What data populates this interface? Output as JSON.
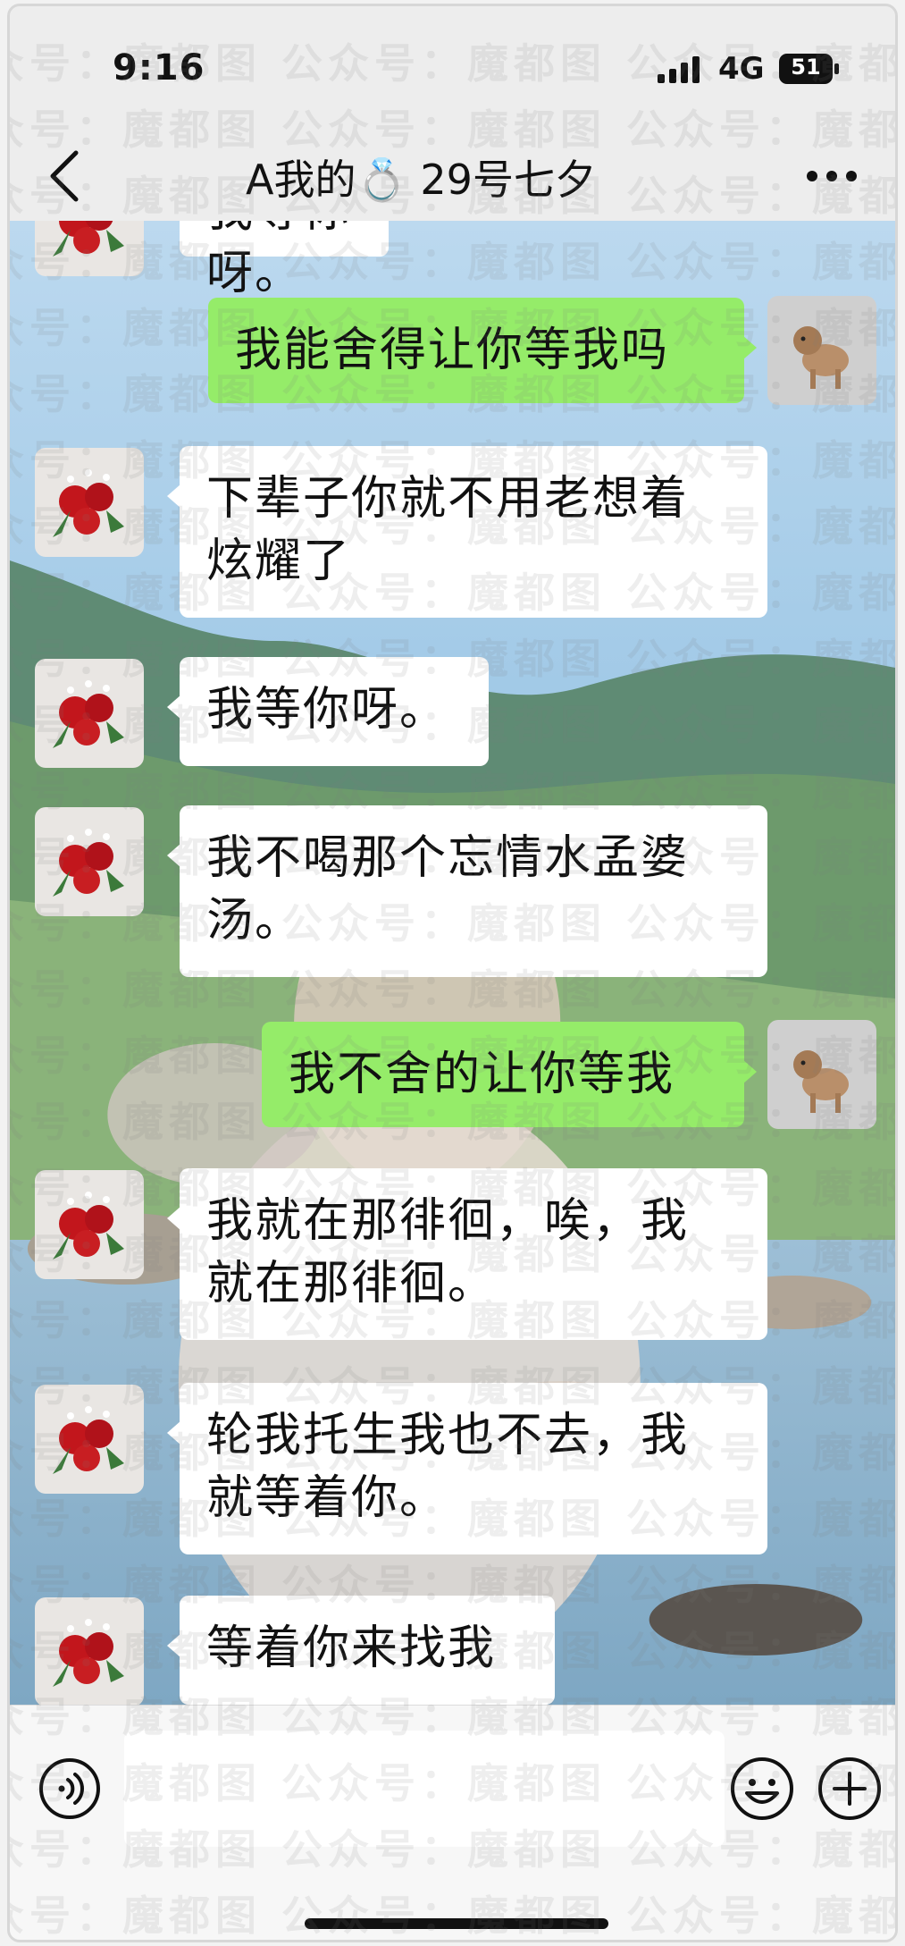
{
  "status_bar": {
    "time": "9:16",
    "network": "4G",
    "battery": "51",
    "signal_icon": "signal-bars-icon",
    "battery_icon": "battery-icon"
  },
  "nav": {
    "back_icon": "chevron-left-icon",
    "title": "A我的💍 29号七夕",
    "more_icon": "more-dots-icon"
  },
  "chat": {
    "messages": [
      {
        "side": "in",
        "text": "我等你呀。"
      },
      {
        "side": "out",
        "text": "我能舍得让你等我吗"
      },
      {
        "side": "in",
        "text": "下辈子你就不用老想着炫耀了"
      },
      {
        "side": "in",
        "text": "我等你呀。"
      },
      {
        "side": "in",
        "text": "我不喝那个忘情水孟婆汤。"
      },
      {
        "side": "out",
        "text": "我不舍的让你等我"
      },
      {
        "side": "in",
        "text": "我就在那徘徊，唉，我就在那徘徊。"
      },
      {
        "side": "in",
        "text": "轮我托生我也不去，我就等着你。"
      },
      {
        "side": "in",
        "text": "等着你来找我"
      }
    ],
    "lines": {
      "m0": [
        "我等你呀。"
      ],
      "m1": [
        "我能舍得让你等我吗"
      ],
      "m2": [
        "下辈子你就不用老想着",
        "炫耀了"
      ],
      "m3": [
        "我等你呀。"
      ],
      "m4": [
        "我不喝那个忘情水孟婆",
        "汤。"
      ],
      "m5": [
        "我不舍的让你等我"
      ],
      "m6": [
        "我就在那徘徊，唉，我",
        "就在那徘徊。"
      ],
      "m7": [
        "轮我托生我也不去，我",
        "就等着你。"
      ],
      "m8": [
        "等着你来找我"
      ]
    },
    "contact_avatar": "rose-bouquet-avatar",
    "my_avatar": "dog-avatar"
  },
  "input_bar": {
    "voice_icon": "voice-icon",
    "emoji_icon": "emoji-icon",
    "plus_icon": "plus-icon",
    "placeholder": ""
  },
  "watermark": {
    "text": "众号：魔都图 公众号：魔都图 公众号：魔都图 公众号：魔都图"
  },
  "colors": {
    "bubble_out": "#95ec69",
    "bubble_in": "#ffffff",
    "bar_bg": "#ededed"
  }
}
